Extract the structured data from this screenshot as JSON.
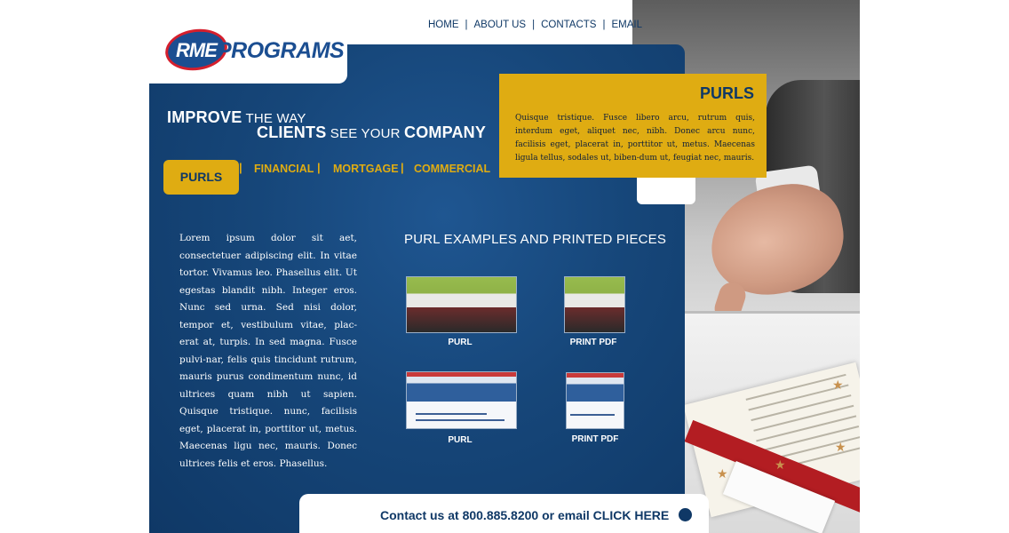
{
  "logo": {
    "badge": "RME",
    "word": "PROGRAMS"
  },
  "top_nav": {
    "home": "HOME",
    "about": "ABOUT US",
    "contacts": "CONTACTS",
    "email": "EMAIL",
    "separator": "|"
  },
  "tagline": {
    "improve": "IMPROVE",
    "the_way": "THE WAY",
    "clients": "CLIENTS",
    "see_your": "SEE YOUR",
    "company": "COMPANY"
  },
  "nav_tabs": {
    "active": "PURLS",
    "financial": "FINANCIAL",
    "mortgage": "MORTGAGE",
    "commercial": "COMMERCIAL",
    "separator": "|"
  },
  "feature_box": {
    "title": "PURLS",
    "text": "Quisque tristique. Fusce libero arcu, rutrum quis, interdum eget, aliquet nec, nibh. Donec arcu nunc, facilisis eget, placerat in, porttitor ut, metus. Maecenas ligula tellus, sodales ut, biben-dum ut, feugiat nec, mauris."
  },
  "body_text": "Lorem ipsum dolor sit aet, consectetuer adipiscing elit. In vitae tortor. Vivamus leo. Phasellus elit. Ut egestas blandit nibh. Integer eros. Nunc sed urna. Sed nisi dolor, tempor et, vestibulum vitae, plac-erat at, turpis. In sed magna. Fusce pulvi-nar, felis quis tincidunt rutrum, mauris purus condimentum nunc, id ultrices quam nibh ut sapien. Quisque tristique. nunc, facilisis eget, placerat in, porttitor ut, metus. Maecenas ligu nec, mauris. Donec ultrices felis et eros. Phasellus.",
  "examples": {
    "title": "PURL EXAMPLES AND PRINTED PIECES",
    "items": [
      {
        "caption": "PURL"
      },
      {
        "caption": "PRINT PDF"
      },
      {
        "caption": "PURL"
      },
      {
        "caption": "PRINT PDF"
      }
    ]
  },
  "contact": {
    "text": "Contact us at 800.885.8200 or email CLICK HERE"
  },
  "colors": {
    "navy": "#0f3866",
    "panel_blue": "#164679",
    "gold": "#dfac12",
    "logo_red": "#d51f2d"
  }
}
